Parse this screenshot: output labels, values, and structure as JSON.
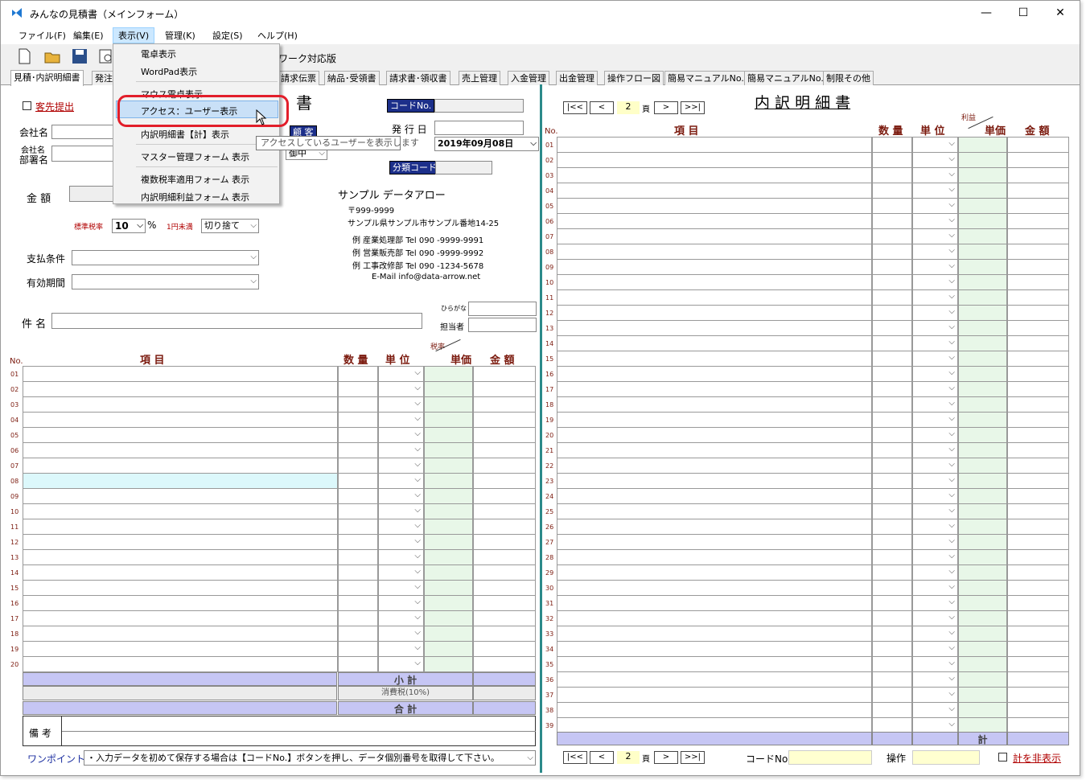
{
  "window": {
    "title": "みんなの見積書（メインフォーム）",
    "min": "—",
    "max": "☐",
    "close": "✕"
  },
  "menubar": [
    "ファイル(F)",
    "編集(E)",
    "表示(V)",
    "管理(K)",
    "設定(S)",
    "ヘルプ(H)"
  ],
  "toolbar": {
    "version_label": "ワーク対応版"
  },
  "tabs": [
    "見積･内訳明細書",
    "発注",
    "請求伝票",
    "納品･受領書",
    "請求書･領収書",
    "売上管理",
    "入金管理",
    "出金管理",
    "操作フロー図",
    "簡易マニュアルNo.1",
    "簡易マニュアルNo.2",
    "制限その他"
  ],
  "view_menu": {
    "items": [
      "電卓表示",
      "WordPad表示",
      "マウス電卓表示",
      "アクセス：ユーザー表示",
      "内訳明細書【計】表示",
      "マスター管理フォーム 表示",
      "複数税率適用フォーム 表示",
      "内訳明細利益フォーム 表示"
    ],
    "tooltip": "アクセスしているユーザーを表示します"
  },
  "left": {
    "customer_check": "客先提出",
    "title_char": "書",
    "code_no": "コードNo.",
    "company": "会社名",
    "dept1": "会社名",
    "dept2": "部署名",
    "customer_btn": "顧 客",
    "honorific": "御中",
    "issue_date_label": "発 行 日",
    "issue_date": "2019年09月08日",
    "class_code": "分類コード",
    "amount_label": "金 額",
    "tax_rate_label": "標準税率",
    "tax_rate": "10",
    "percent": "%",
    "yen_label": "1円未満",
    "rounding": "切り捨て",
    "payment_label": "支払条件",
    "validity_label": "有効期間",
    "subject_label": "件 名",
    "kana_label": "ひらがな",
    "person_label": "担当者",
    "issuer": {
      "name": "サンプル データアロー",
      "zip": "〒999-9999",
      "addr": "サンプル県サンプル市サンプル番地14-25",
      "d1": "例  産業処理部    Tel  090 -9999-9991",
      "d2": "例  営業販売部    Tel  090 -9999-9992",
      "d3": "例  工事改修部    Tel  090 -1234-5678",
      "mail": "E-Mail  info@data-arrow.net"
    },
    "grid": {
      "no": "No.",
      "item": "項            目",
      "qty": "数 量",
      "unit": "単 位",
      "tax": "税率",
      "price": "単価",
      "amount": "金 額",
      "rows": [
        "01",
        "02",
        "03",
        "04",
        "05",
        "06",
        "07",
        "08",
        "09",
        "10",
        "11",
        "12",
        "13",
        "14",
        "15",
        "16",
        "17",
        "18",
        "19",
        "20"
      ]
    },
    "subtotal": "小  計",
    "tax_line": "消費税(10%)",
    "total": "合  計",
    "memo": "備 考",
    "onepoint": "ワンポイント:",
    "hint": "・入力データを初めて保存する場合は【コードNo.】ボタンを押し、データ個別番号を取得して下さい。"
  },
  "right": {
    "title": "内 訳 明 細 書",
    "page": "2",
    "page_unit": "頁",
    "nav": [
      "|<<",
      "<",
      ">",
      ">>|"
    ],
    "grid": {
      "no": "No.",
      "item": "項            目",
      "qty": "数 量",
      "unit": "単 位",
      "profit": "利益",
      "price": "単価",
      "amount": "金 額",
      "rows": [
        "01",
        "02",
        "03",
        "04",
        "05",
        "06",
        "07",
        "08",
        "09",
        "10",
        "11",
        "12",
        "13",
        "14",
        "15",
        "16",
        "17",
        "18",
        "19",
        "20",
        "21",
        "22",
        "23",
        "24",
        "25",
        "26",
        "27",
        "28",
        "29",
        "30",
        "31",
        "32",
        "33",
        "34",
        "35",
        "36",
        "37",
        "38",
        "39"
      ]
    },
    "total": "計",
    "code_no": "コードNo.",
    "operation": "操作",
    "toggle": "計を非表示"
  }
}
